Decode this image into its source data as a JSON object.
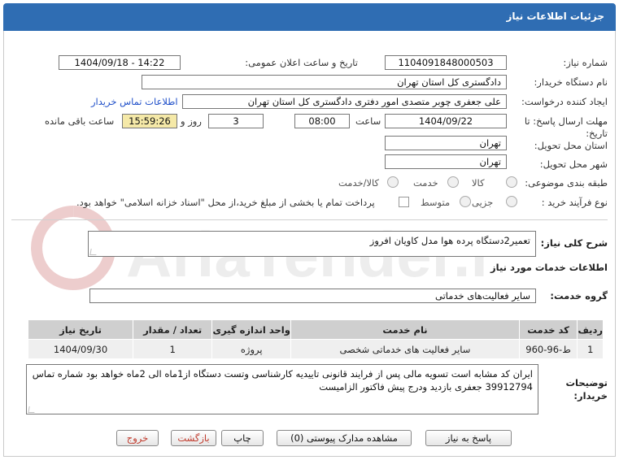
{
  "header": {
    "title": "جزئیات اطلاعات نیاز"
  },
  "watermark": {
    "text": "AriaTender.neT"
  },
  "fields": {
    "need_number_label": "شماره نیاز:",
    "need_number": "1104091848000503",
    "announce_label": "تاریخ و ساعت اعلان عمومی:",
    "announce_value": "1404/09/18 - 14:22",
    "buyer_org_label": "نام دستگاه خریدار:",
    "buyer_org": "دادگستری کل استان تهران",
    "creator_label": "ایجاد کننده درخواست:",
    "creator": "علی جعفری چوبر متصدی امور دفتری دادگستری کل استان تهران",
    "contact_link": "اطلاعات تماس خریدار",
    "deadline_label": "مهلت ارسال پاسخ: تا تاریخ:",
    "deadline_date": "1404/09/22",
    "time_label": "ساعت",
    "deadline_time": "08:00",
    "days_value": "3",
    "days_label": "روز و",
    "remaining_time": "15:59:26",
    "remaining_label": "ساعت باقی مانده",
    "province_label": "استان محل تحویل:",
    "province": "تهران",
    "city_label": "شهر محل تحویل:",
    "city": "تهران",
    "category_label": "طبقه بندی موضوعی:",
    "category_options": [
      "کالا",
      "خدمت",
      "کالا/خدمت"
    ],
    "purchase_type_label": "نوع فرآیند خرید :",
    "purchase_options": [
      "جزیی",
      "متوسط"
    ],
    "payment_note": "پرداخت تمام یا بخشی از مبلغ خرید،از محل \"اسناد خزانه اسلامی\" خواهد بود."
  },
  "description": {
    "label": "شرح کلی نیاز:",
    "value": "تعمیر2دستگاه پرده هوا مدل کاویان افروز"
  },
  "services": {
    "section_title": "اطلاعات خدمات مورد نیاز",
    "group_label": "گروه خدمت:",
    "group_value": "سایر فعالیت‌های خدماتی",
    "columns": [
      "ردیف",
      "کد خدمت",
      "نام خدمت",
      "واحد اندازه گیری",
      "تعداد / مقدار",
      "تاریخ نیاز"
    ],
    "rows": [
      [
        "1",
        "ط-96-960",
        "سایر فعالیت های خدماتی شخصی",
        "پروژه",
        "1",
        "1404/09/30"
      ]
    ]
  },
  "buyer_notes": {
    "label": "توضیحات خریدار:",
    "value": "ایران کد مشابه است تسویه مالی پس از فرایند قانونی تاییدیه کارشناسی وتست دستگاه  از1ماه الی 2ماه خواهد بود شماره تماس 39912794 جعفری بازدید ودرج پیش فاکتور الزامیست"
  },
  "buttons": {
    "reply": "پاسخ به نیاز",
    "attachments": "مشاهده مدارک پیوستی (0)",
    "print": "چاپ",
    "back": "بازگشت",
    "exit": "خروج"
  }
}
